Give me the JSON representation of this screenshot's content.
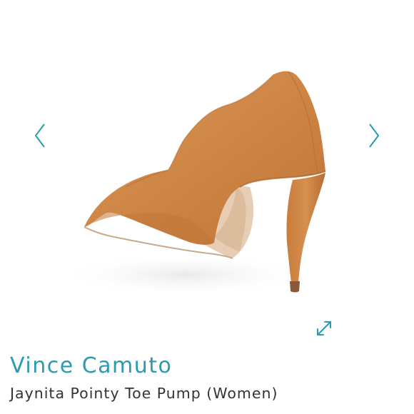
{
  "colors": {
    "accent": "#2a9bb1",
    "title_text": "#333333",
    "shoe_suede": "#d08a47"
  },
  "icons": {
    "prev": "chevron-left-icon",
    "next": "chevron-right-icon",
    "expand": "expand-icon"
  },
  "product": {
    "brand": "Vince Camuto",
    "name": "Jaynita Pointy Toe Pump (Women)"
  }
}
